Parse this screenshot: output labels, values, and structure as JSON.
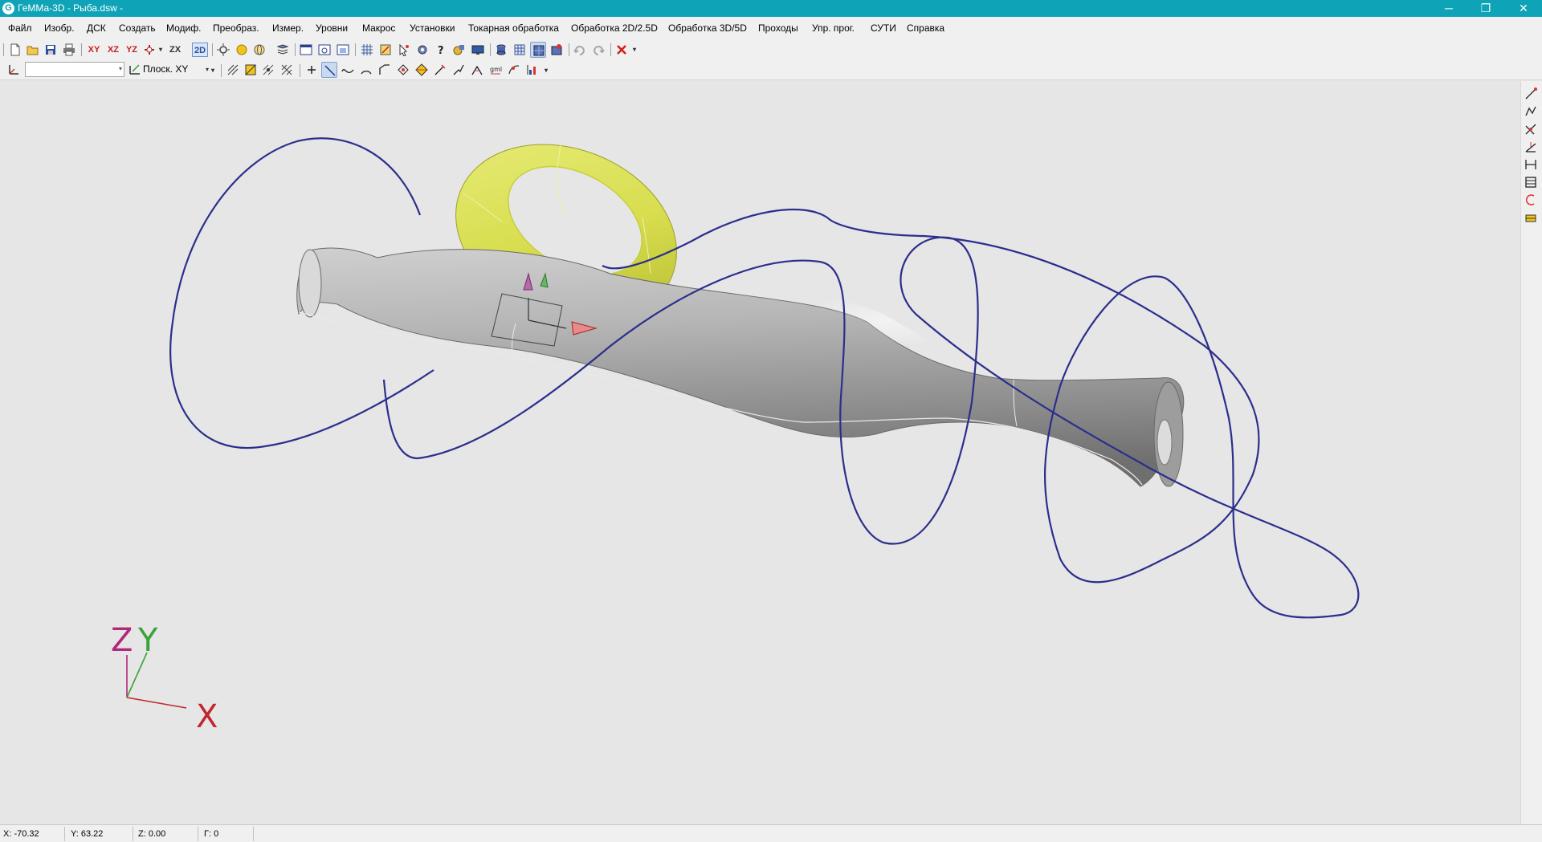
{
  "window": {
    "title": "ГеММа-3D - Рыба.dsw -",
    "app_icon": "G",
    "controls": [
      "─",
      "❐",
      "✕"
    ]
  },
  "menu": [
    "Файл",
    "Изобр.",
    "ДСК",
    "Создать",
    "Модиф.",
    "Преобраз.",
    "Измер.",
    "Уровни",
    "Макрос",
    "Установки",
    "Токарная обработка",
    "Обработка 2D/2.5D",
    "Обработка 3D/5D",
    "Проходы",
    "Упр. прог.",
    "СУТИ",
    "Справка"
  ],
  "toolbar1": {
    "xy_label": "XY",
    "xz_label": "XZ",
    "yz_label": "YZ",
    "zx_label": "ZX",
    "mode_2d_label": "2D"
  },
  "toolbar2": {
    "ucs_value": "",
    "plane_label": "Плоск. XY"
  },
  "viewport": {
    "axis_labels": {
      "z": "Z",
      "y": "Y",
      "x": "X"
    },
    "colors": {
      "background": "#e6e6e6",
      "body_surface": "#9a9a9a",
      "torus_surface": "#d6dc52",
      "curve": "#2b2f8c",
      "axis_x": "#c0282d",
      "axis_y": "#3aa23a",
      "axis_z": "#b0287a"
    }
  },
  "status": {
    "x": "X: -70.32",
    "y": "Y: 63.22",
    "z": "Z: 0.00",
    "g": "Г: 0"
  }
}
